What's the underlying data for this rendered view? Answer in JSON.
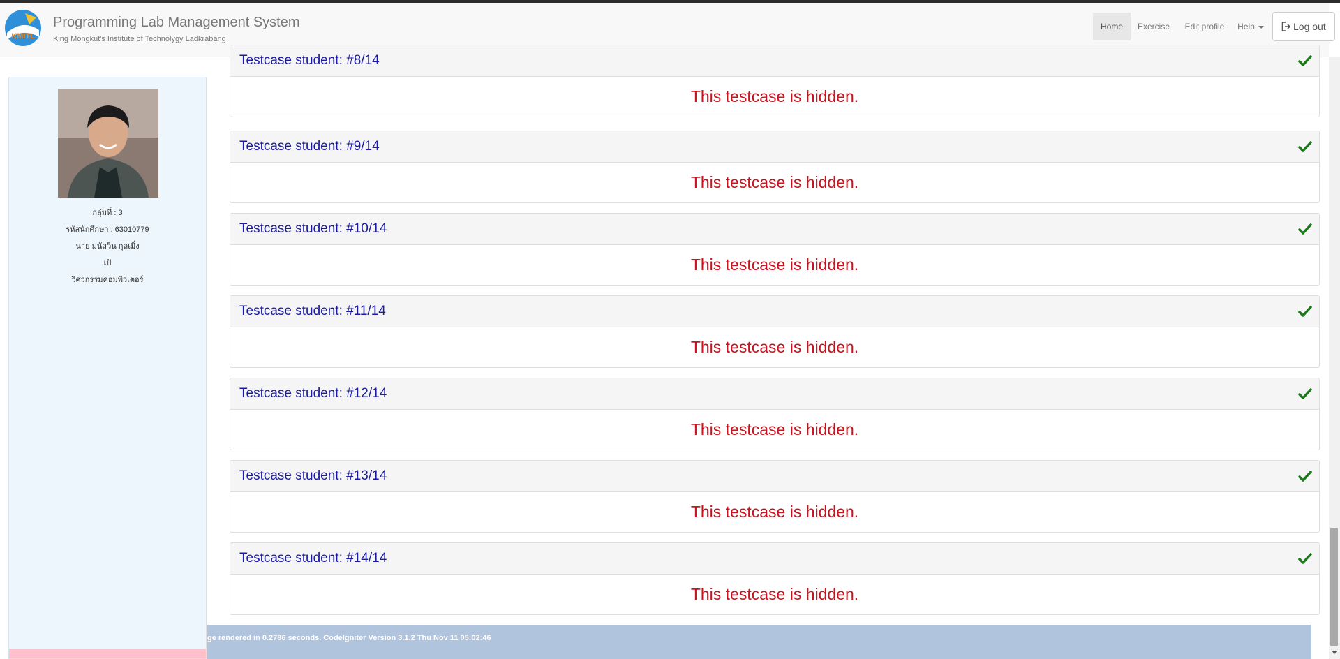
{
  "header": {
    "title": "Programming Lab Management System",
    "subtitle": "King Mongkut's Institute of Technolygy Ladkrabang",
    "logo_text": "KMITL",
    "nav": [
      {
        "label": "Home",
        "active": true
      },
      {
        "label": "Exercise",
        "active": false
      },
      {
        "label": "Edit profile",
        "active": false
      },
      {
        "label": "Help",
        "active": false
      }
    ],
    "logout_label": "Log out"
  },
  "sidebar": {
    "group": "กลุ่มที่ : 3",
    "student_id": "รหัสนักศึกษา : 63010779",
    "name": "นาย มนัสวิน กุลเมิ่ง",
    "nickname": "เป้",
    "department": "วิศวกรรมคอมพิวเตอร์"
  },
  "testcases": [
    {
      "title": "Testcase student: #8/14",
      "message": "This testcase is hidden.",
      "passed": true
    },
    {
      "title": "Testcase student: #9/14",
      "message": "This testcase is hidden.",
      "passed": true
    },
    {
      "title": "Testcase student: #10/14",
      "message": "This testcase is hidden.",
      "passed": true
    },
    {
      "title": "Testcase student: #11/14",
      "message": "This testcase is hidden.",
      "passed": true
    },
    {
      "title": "Testcase student: #12/14",
      "message": "This testcase is hidden.",
      "passed": true
    },
    {
      "title": "Testcase student: #13/14",
      "message": "This testcase is hidden.",
      "passed": true
    },
    {
      "title": "Testcase student: #14/14",
      "message": "This testcase is hidden.",
      "passed": true
    }
  ],
  "footer": {
    "text": "ge rendered in 0.2786 seconds. CodeIgniter Version 3.1.2 Thu Nov 11 05:02:46"
  },
  "colors": {
    "testcase_title": "#1a1aa6",
    "hidden_message": "#c8141e",
    "check": "#1a7a1a",
    "footer_bg": "#b0c4de",
    "sidebar_bg": "#eef6fd"
  }
}
